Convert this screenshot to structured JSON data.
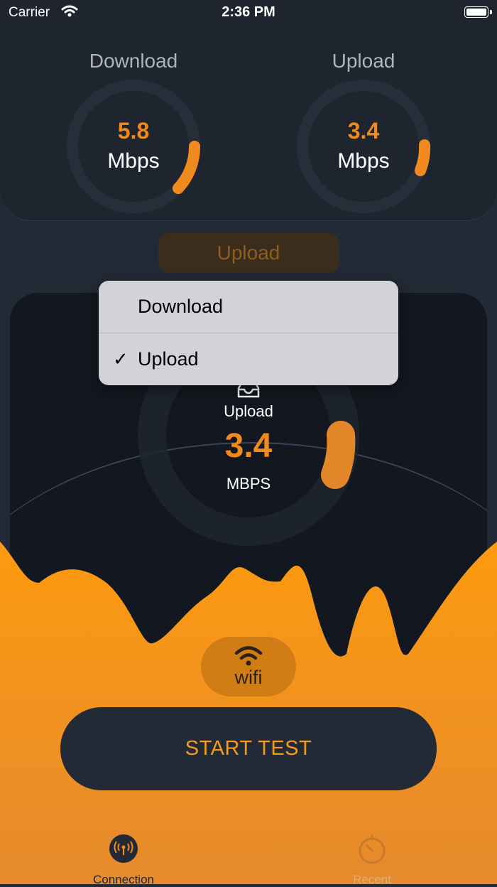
{
  "status_bar": {
    "carrier": "Carrier",
    "time": "2:36 PM"
  },
  "gauges": {
    "download": {
      "title": "Download",
      "value": "5.8",
      "unit": "Mbps"
    },
    "upload": {
      "title": "Upload",
      "value": "3.4",
      "unit": "Mbps"
    }
  },
  "mode_button": {
    "label": "Upload"
  },
  "menu": {
    "items": [
      {
        "label": "Download",
        "checked": false
      },
      {
        "label": "Upload",
        "checked": true
      }
    ],
    "check_glyph": "✓"
  },
  "hero": {
    "label": "Upload",
    "value": "3.4",
    "unit": "MBPS",
    "icon": "inbox-icon"
  },
  "connection_badge": {
    "label": "wifi",
    "icon": "wifi-icon"
  },
  "start_button": {
    "label": "START TEST"
  },
  "tabs": [
    {
      "label": "Connection",
      "icon": "antenna-icon",
      "active": true
    },
    {
      "label": "Recent",
      "icon": "timer-icon",
      "active": false
    }
  ],
  "colors": {
    "accent": "#f08a1e",
    "background": "#222a35",
    "card": "#1e252e",
    "wave_top": "#fd9a10",
    "wave_bottom": "#e58a2e"
  }
}
